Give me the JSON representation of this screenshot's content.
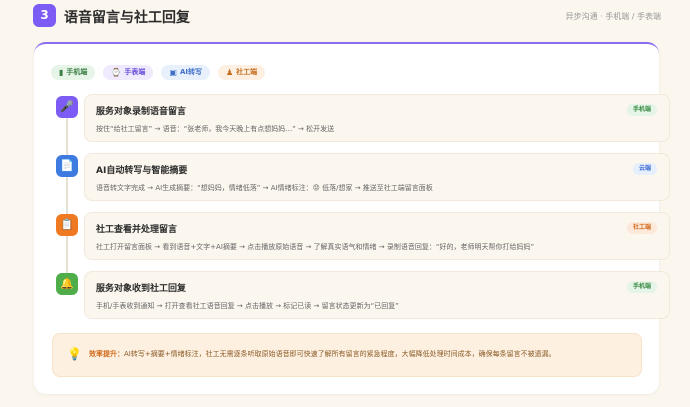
{
  "header": {
    "step_number": "3",
    "title": "语音留言与社工回复",
    "breadcrumb": "异步沟通 · 手机端 / 手表端"
  },
  "chips": [
    {
      "icon": "phone-icon",
      "glyph": "▮",
      "label": "手机端",
      "color": "#3b7f44"
    },
    {
      "icon": "watch-icon",
      "glyph": "⌚",
      "label": "手表端",
      "color": "#6b4fd8"
    },
    {
      "icon": "ai-icon",
      "glyph": "▣",
      "label": "AI转写",
      "color": "#3f6fc9"
    },
    {
      "icon": "social-worker-icon",
      "glyph": "♟",
      "label": "社工端",
      "color": "#c46b1c"
    }
  ],
  "steps": [
    {
      "icon": "microphone-icon",
      "icon_color": "#7c5cf5",
      "title": "服务对象录制语音留言",
      "desc": "按住“给社工留言” → 语音：“张老师，我今天晚上有点想妈妈…” → 松开发送",
      "tag": "手机端",
      "tag_color": "#3b8a45"
    },
    {
      "icon": "document-icon",
      "icon_color": "#3d7be0",
      "title": "AI自动转写与智能摘要",
      "desc": "语音转文字完成 → AI生成摘要：“想妈妈，情绪低落” → AI情绪标注：😟 低落/想家 → 推送至社工端留言面板",
      "tag": "云端",
      "tag_color": "#3d6bd0"
    },
    {
      "icon": "clipboard-icon",
      "icon_color": "#f07a22",
      "title": "社工查看并处理留言",
      "desc": "社工打开留言面板 → 看到语音+文字+AI摘要 → 点击播放原始语音 → 了解真实语气和情绪 → 录制语音回复：“好的，老师明天帮你打给妈妈”",
      "tag": "社工端",
      "tag_color": "#d0681b"
    },
    {
      "icon": "bell-icon",
      "icon_color": "#4fae4a",
      "title": "服务对象收到社工回复",
      "desc": "手机/手表收到通知 → 打开查看社工语音回复 → 点击播放 → 标记已读 → 留言状态更新为“已回复”",
      "tag": "手机端",
      "tag_color": "#3b8a45"
    }
  ],
  "footer": {
    "label": "效率提升：",
    "text": "AI转写+摘要+情绪标注，社工无需逐条听取原始语音即可快速了解所有留言的紧急程度，大幅降低处理时间成本，确保每条留言不被遗漏。"
  }
}
